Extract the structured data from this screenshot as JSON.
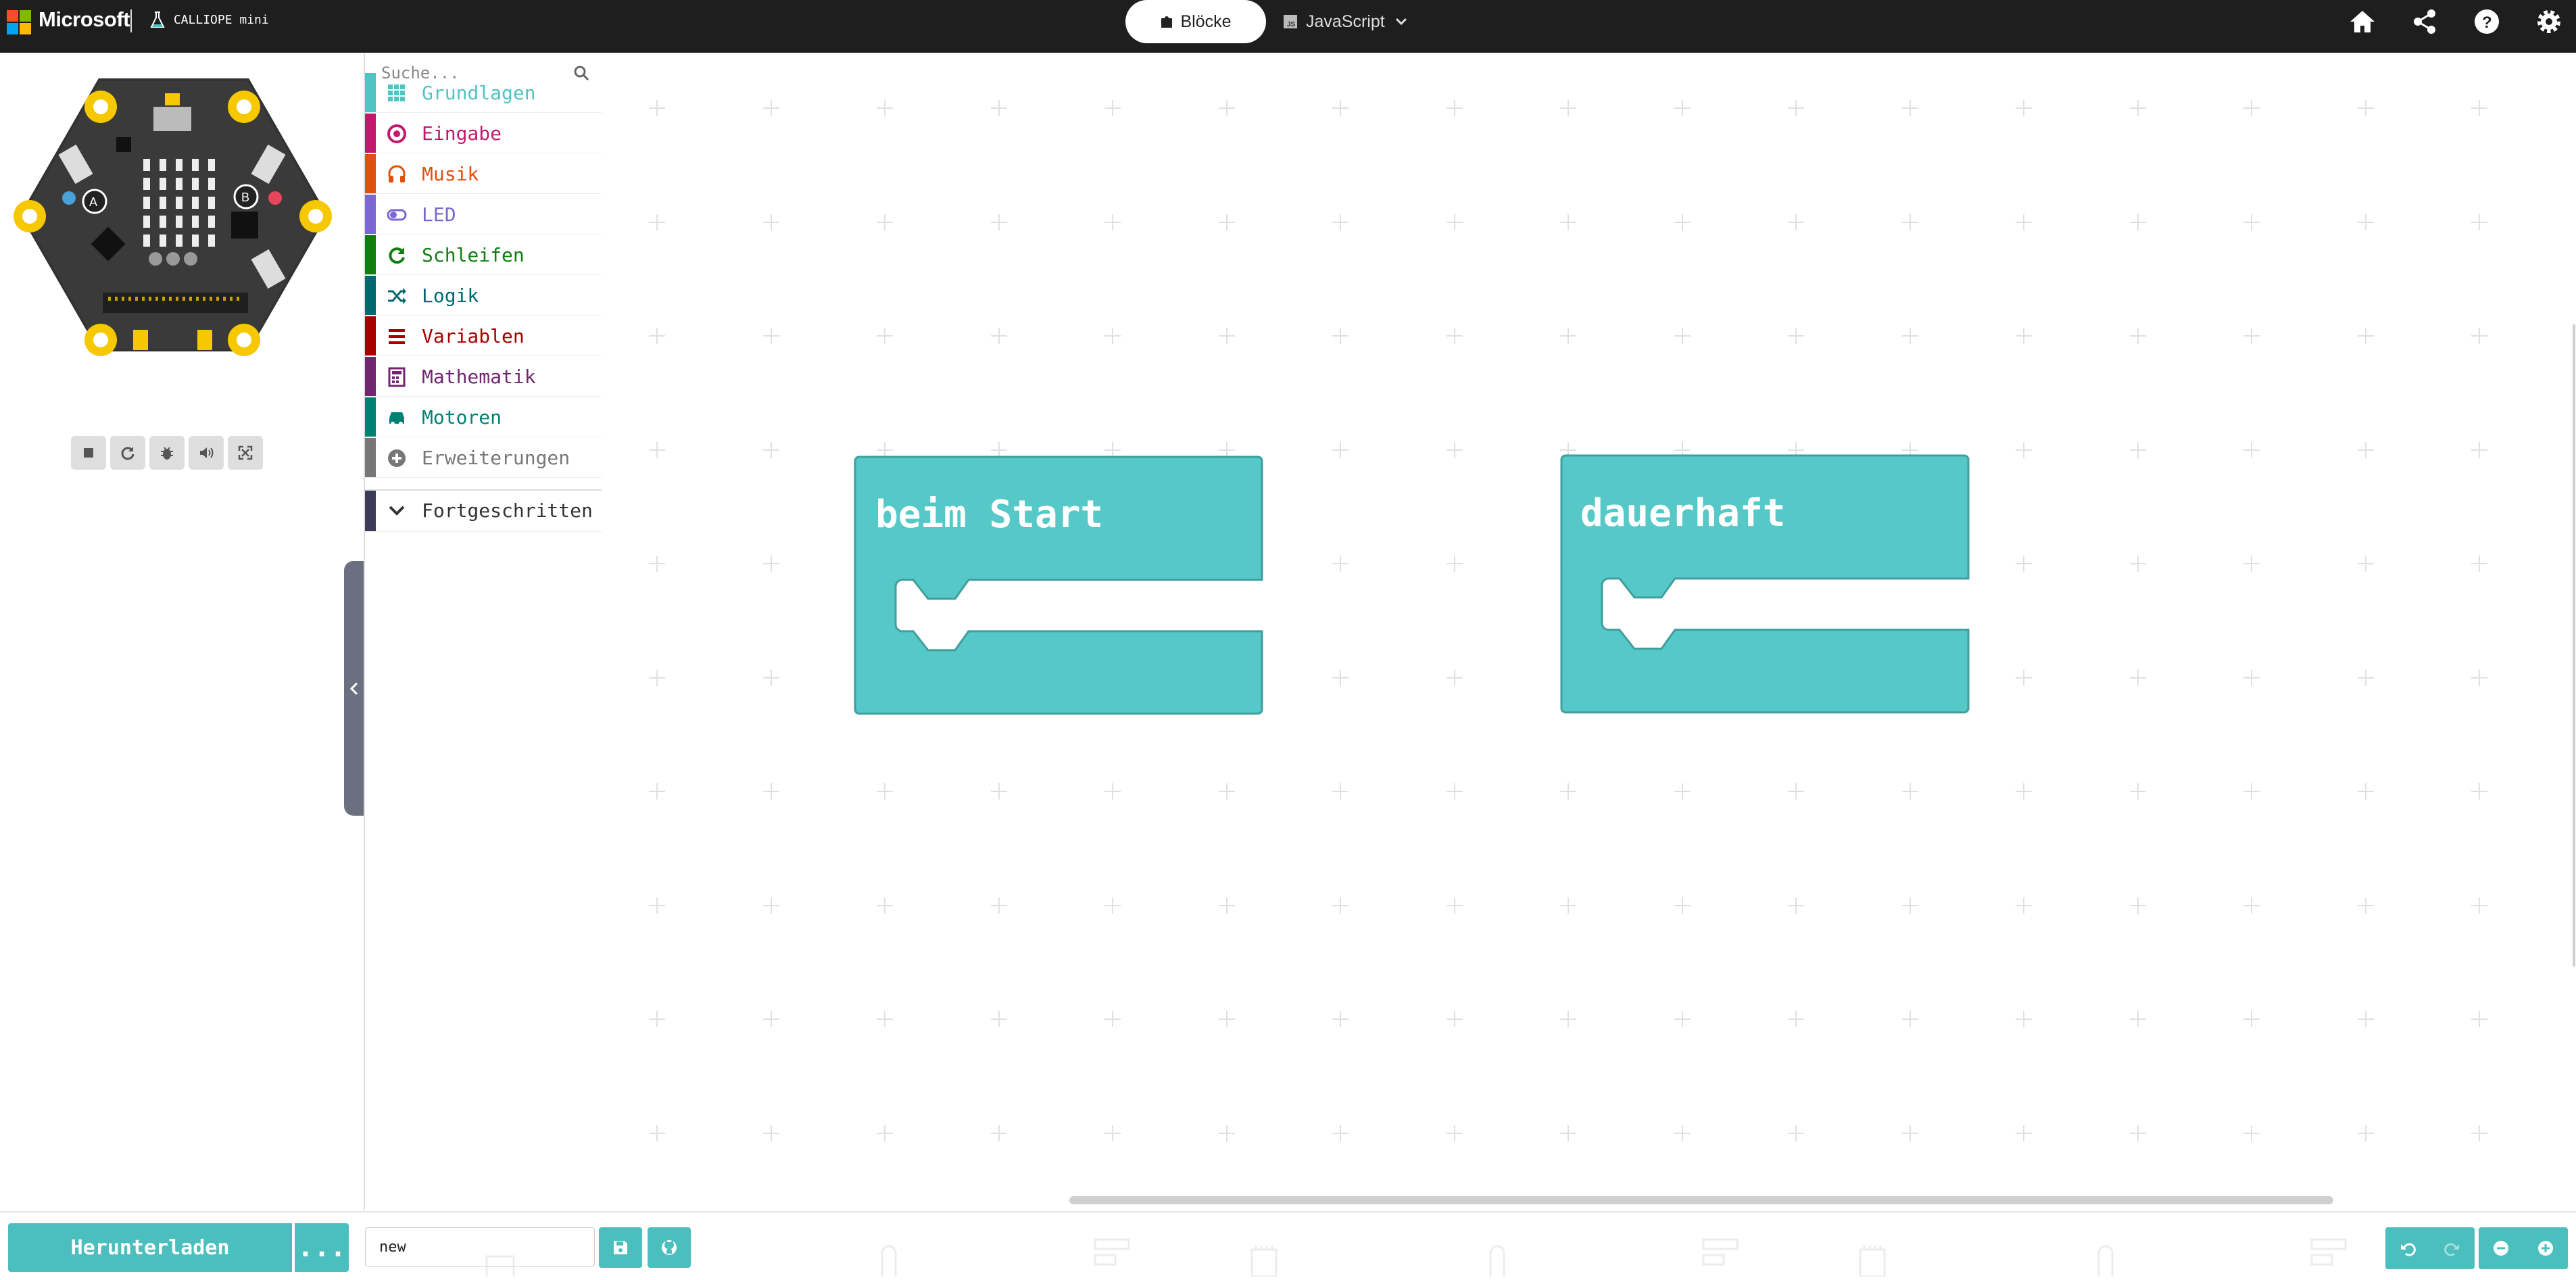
{
  "header": {
    "brand": "Microsoft",
    "product": "CALLIOPE mini",
    "tabs": [
      {
        "label": "Blöcke",
        "active": true
      },
      {
        "label": "JavaScript",
        "active": false
      }
    ],
    "icons": [
      "home-icon",
      "share-icon",
      "help-icon",
      "settings-icon"
    ]
  },
  "simulator": {
    "tools": [
      "stop-icon",
      "restart-icon",
      "debug-icon",
      "sound-icon",
      "fullscreen-icon"
    ]
  },
  "toolbox": {
    "search_placeholder": "Suche...",
    "categories": [
      {
        "label": "Grundlagen",
        "color": "#4fc4c4",
        "icon": "grid-icon"
      },
      {
        "label": "Eingabe",
        "color": "#c3196c",
        "icon": "target-icon"
      },
      {
        "label": "Musik",
        "color": "#e0500f",
        "icon": "headphones-icon"
      },
      {
        "label": "LED",
        "color": "#7b67d4",
        "icon": "toggle-icon"
      },
      {
        "label": "Schleifen",
        "color": "#117e11",
        "icon": "loop-icon"
      },
      {
        "label": "Logik",
        "color": "#006970",
        "icon": "shuffle-icon"
      },
      {
        "label": "Variablen",
        "color": "#a80000",
        "icon": "list-icon"
      },
      {
        "label": "Mathematik",
        "color": "#712672",
        "icon": "calculator-icon"
      },
      {
        "label": "Motoren",
        "color": "#008272",
        "icon": "car-icon"
      },
      {
        "label": "Erweiterungen",
        "color": "#777777",
        "icon": "plus-circle-icon"
      },
      {
        "label": "Fortgeschritten",
        "color": "#3c3c5a",
        "icon": "chevron-down-icon"
      }
    ]
  },
  "workspace": {
    "blocks": [
      {
        "label": "beim Start",
        "color": "#57c8c8"
      },
      {
        "label": "dauerhaft",
        "color": "#57c8c8"
      }
    ]
  },
  "footer": {
    "download_label": "Herunterladen",
    "more_label": "...",
    "project_name": "new"
  },
  "colors": {
    "accent": "#4bbebe",
    "topbar": "#1e1e1e",
    "block": "#57c8c8"
  }
}
